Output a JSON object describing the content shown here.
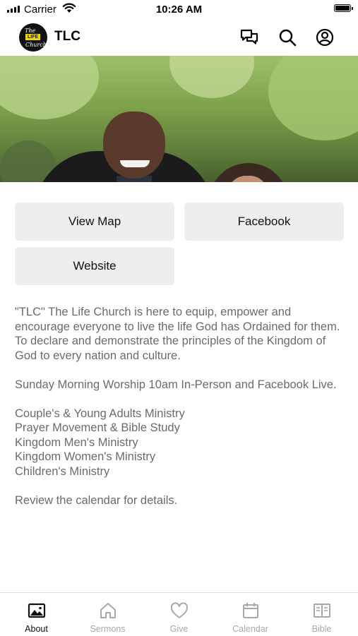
{
  "status_bar": {
    "carrier": "Carrier",
    "time": "10:26 AM"
  },
  "header": {
    "logo_text": {
      "top": "The",
      "middle": "LIFE",
      "bottom": "Church"
    },
    "title": "TLC",
    "icons": [
      "chat-bubbles-icon",
      "search-icon",
      "account-icon"
    ]
  },
  "hero": {
    "icon": "church-pastors-photo"
  },
  "buttons": {
    "view_map": "View Map",
    "facebook": "Facebook",
    "website": "Website"
  },
  "description": {
    "intro": "\"TLC\" The Life Church is here to equip, empower and encourage everyone to live the life God has Ordained for them. To declare and demonstrate the principles of the Kingdom of God to every nation and culture.",
    "worship": "Sunday Morning Worship 10am In-Person and Facebook Live.",
    "ministries": [
      "Couple's & Young Adults Ministry",
      "Prayer Movement & Bible Study",
      "Kingdom Men's Ministry",
      "Kingdom Women's Ministry",
      "Children's Ministry"
    ],
    "closing": "Review the calendar for details."
  },
  "tab_bar": {
    "active": "About",
    "tabs": [
      {
        "label": "About",
        "icon": "image-icon"
      },
      {
        "label": "Sermons",
        "icon": "home-icon"
      },
      {
        "label": "Give",
        "icon": "heart-icon"
      },
      {
        "label": "Calendar",
        "icon": "calendar-icon"
      },
      {
        "label": "Bible",
        "icon": "book-icon"
      }
    ]
  },
  "colors": {
    "button_bg": "#eceeef",
    "text_body": "#6b6b6b",
    "tab_inactive": "#a8a8a8",
    "tab_active": "#111111"
  }
}
